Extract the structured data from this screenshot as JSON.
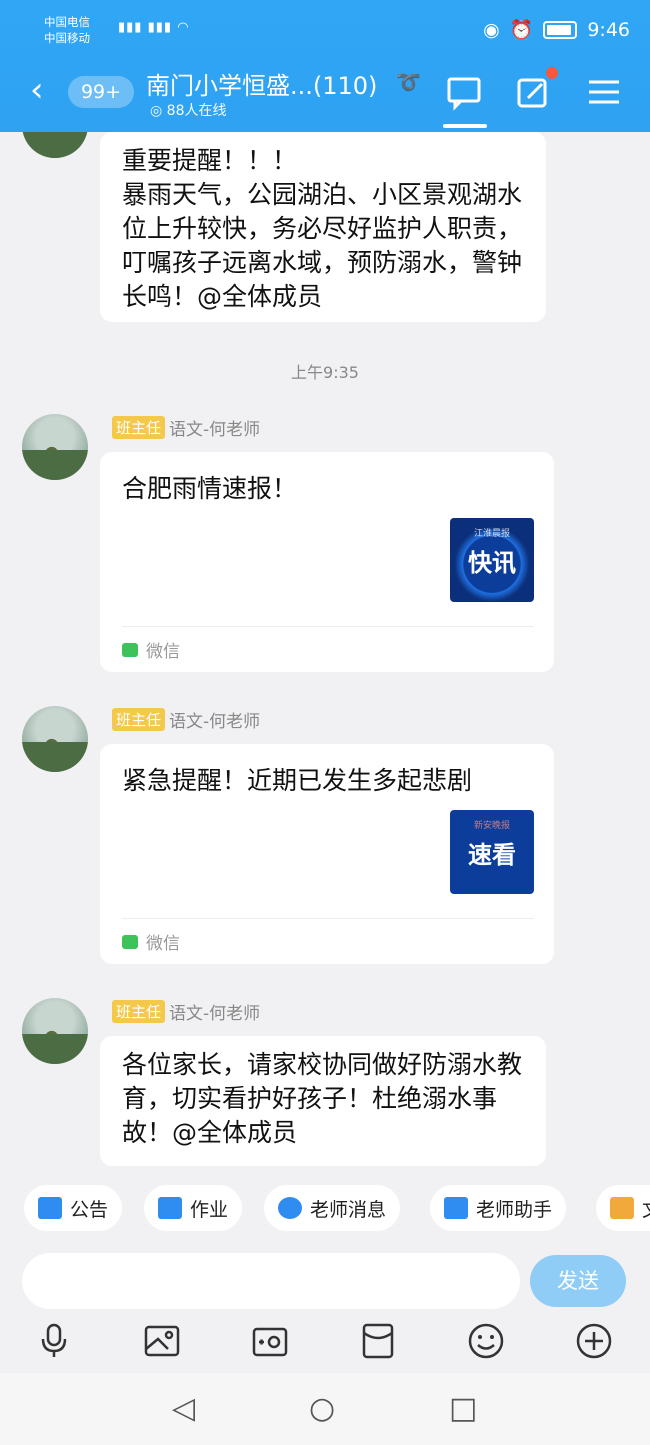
{
  "status_bar": {
    "carrier1": "中国电信",
    "carrier2": "中国移动",
    "signal": "5G 4G",
    "time": "9:46"
  },
  "header": {
    "back_label": "‹",
    "unread_count": "99+",
    "group_title": "南门小学恒盛...(110)",
    "online_text": "88人在线"
  },
  "messages": [
    {
      "text": "重要提醒！！！\n暴雨天气，公园湖泊、小区景观湖水位上升较快，务必尽好监护人职责，叮嘱孩子远离水域，预防溺水，警钟长鸣！@全体成员"
    },
    {
      "timestamp": "上午9:35"
    },
    {
      "role": "班主任",
      "sender": "语文-何老师",
      "text": "合肥雨情速报！",
      "thumb_label": "快讯",
      "source": "微信"
    },
    {
      "role": "班主任",
      "sender": "语文-何老师",
      "text": "紧急提醒！近期已发生多起悲剧",
      "thumb_label": "速看",
      "source": "微信"
    },
    {
      "role": "班主任",
      "sender": "语文-何老师",
      "text": "各位家长，请家校协同做好防溺水教育，切实看护好孩子！杜绝溺水事故！@全体成员"
    }
  ],
  "quick_actions": [
    {
      "label": "公告",
      "icon": "announcement-icon",
      "color": "#2f8cf0"
    },
    {
      "label": "作业",
      "icon": "homework-icon",
      "color": "#2f8cf0"
    },
    {
      "label": "老师消息",
      "icon": "teacher-message-icon",
      "color": "#2f8cf0"
    },
    {
      "label": "老师助手",
      "icon": "teacher-assistant-icon",
      "color": "#2f8cf0"
    },
    {
      "label": "文",
      "icon": "folder-icon",
      "color": "#f2a93b"
    }
  ],
  "input": {
    "placeholder": "",
    "send_label": "发送"
  },
  "colors": {
    "header": "#2fa2f2",
    "send": "#8fcdf7",
    "badge": "#f4c84a"
  }
}
